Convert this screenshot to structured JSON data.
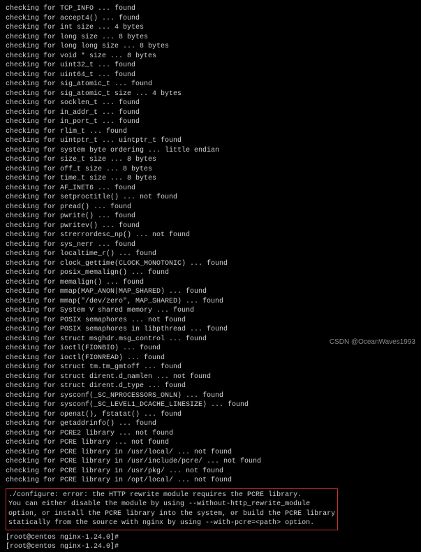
{
  "checks": [
    "checking for TCP_INFO ... found",
    "checking for accept4() ... found",
    "checking for int size ... 4 bytes",
    "checking for long size ... 8 bytes",
    "checking for long long size ... 8 bytes",
    "checking for void * size ... 8 bytes",
    "checking for uint32_t ... found",
    "checking for uint64_t ... found",
    "checking for sig_atomic_t ... found",
    "checking for sig_atomic_t size ... 4 bytes",
    "checking for socklen_t ... found",
    "checking for in_addr_t ... found",
    "checking for in_port_t ... found",
    "checking for rlim_t ... found",
    "checking for uintptr_t ... uintptr_t found",
    "checking for system byte ordering ... little endian",
    "checking for size_t size ... 8 bytes",
    "checking for off_t size ... 8 bytes",
    "checking for time_t size ... 8 bytes",
    "checking for AF_INET6 ... found",
    "checking for setproctitle() ... not found",
    "checking for pread() ... found",
    "checking for pwrite() ... found",
    "checking for pwritev() ... found",
    "checking for strerrordesc_np() ... not found",
    "checking for sys_nerr ... found",
    "checking for localtime_r() ... found",
    "checking for clock_gettime(CLOCK_MONOTONIC) ... found",
    "checking for posix_memalign() ... found",
    "checking for memalign() ... found",
    "checking for mmap(MAP_ANON|MAP_SHARED) ... found",
    "checking for mmap(\"/dev/zero\", MAP_SHARED) ... found",
    "checking for System V shared memory ... found",
    "checking for POSIX semaphores ... not found",
    "checking for POSIX semaphores in libpthread ... found",
    "checking for struct msghdr.msg_control ... found",
    "checking for ioctl(FIONBIO) ... found",
    "checking for ioctl(FIONREAD) ... found",
    "checking for struct tm.tm_gmtoff ... found",
    "checking for struct dirent.d_namlen ... not found",
    "checking for struct dirent.d_type ... found",
    "checking for sysconf(_SC_NPROCESSORS_ONLN) ... found",
    "checking for sysconf(_SC_LEVEL1_DCACHE_LINESIZE) ... found",
    "checking for openat(), fstatat() ... found",
    "checking for getaddrinfo() ... found",
    "checking for PCRE2 library ... not found",
    "checking for PCRE library ... not found",
    "checking for PCRE library in /usr/local/ ... not found",
    "checking for PCRE library in /usr/include/pcre/ ... not found",
    "checking for PCRE library in /usr/pkg/ ... not found",
    "checking for PCRE library in /opt/local/ ... not found"
  ],
  "error": {
    "l1": "./configure: error: the HTTP rewrite module requires the PCRE library.",
    "l2": "You can either disable the module by using --without-http_rewrite_module",
    "l3": "option, or install the PCRE library into the system, or build the PCRE library",
    "l4": "statically from the source with nginx by using --with-pcre=<path> option."
  },
  "prompt1": "[root@centos nginx-1.24.0]#",
  "prompt2": "[root@centos nginx-1.24.0]#",
  "watermark": "CSDN @OceanWaves1993"
}
